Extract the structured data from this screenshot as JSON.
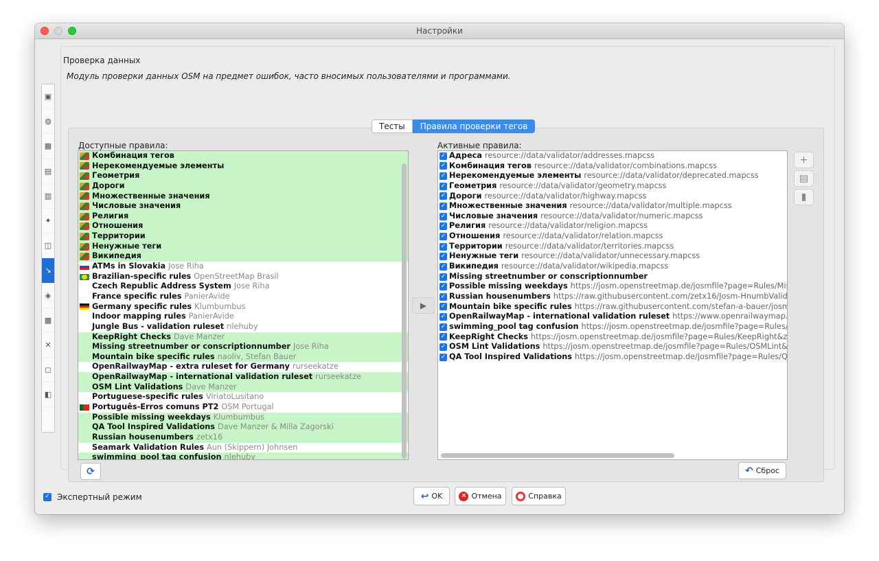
{
  "window": {
    "title": "Настройки"
  },
  "header": {
    "title": "Проверка данных",
    "description": "Модуль проверки данных OSM на предмет ошибок, часто вносимых пользователями и программами."
  },
  "tabs": [
    {
      "label": "Тесты"
    },
    {
      "label": "Правила проверки тегов"
    }
  ],
  "available": {
    "label": "Доступные правила:",
    "items": [
      {
        "name": "Комбинация тегов",
        "author": "",
        "icon": "josm",
        "hl": true
      },
      {
        "name": "Нерекомендуемые элементы",
        "author": "",
        "icon": "josm",
        "hl": true
      },
      {
        "name": "Геометрия",
        "author": "",
        "icon": "josm",
        "hl": true
      },
      {
        "name": "Дороги",
        "author": "",
        "icon": "josm",
        "hl": true
      },
      {
        "name": "Множественные значения",
        "author": "",
        "icon": "josm",
        "hl": true
      },
      {
        "name": "Числовые значения",
        "author": "",
        "icon": "josm",
        "hl": true
      },
      {
        "name": "Религия",
        "author": "",
        "icon": "josm",
        "hl": true
      },
      {
        "name": "Отношения",
        "author": "",
        "icon": "josm",
        "hl": true
      },
      {
        "name": "Территории",
        "author": "",
        "icon": "josm",
        "hl": true
      },
      {
        "name": "Ненужные теги",
        "author": "",
        "icon": "josm",
        "hl": true
      },
      {
        "name": "Википедия",
        "author": "",
        "icon": "josm",
        "hl": true
      },
      {
        "name": "ATMs in Slovakia",
        "author": "Jose Riha",
        "icon": "sk",
        "hl": false
      },
      {
        "name": "Brazilian-specific rules",
        "author": "OpenStreetMap Brasil",
        "icon": "br",
        "hl": false
      },
      {
        "name": "Czech Republic Address System",
        "author": "Jose Riha",
        "icon": "",
        "hl": false
      },
      {
        "name": "France specific rules",
        "author": "PanierAvide",
        "icon": "",
        "hl": false
      },
      {
        "name": "Germany specific rules",
        "author": "Klumbumbus",
        "icon": "de",
        "hl": false
      },
      {
        "name": "Indoor mapping rules",
        "author": "PanierAvide",
        "icon": "",
        "hl": false
      },
      {
        "name": "Jungle Bus - validation ruleset",
        "author": "nlehuby",
        "icon": "",
        "hl": false
      },
      {
        "name": "KeepRight Checks",
        "author": "Dave Manzer",
        "icon": "",
        "hl": true
      },
      {
        "name": "Missing streetnumber or conscriptionnumber",
        "author": "Jose Riha",
        "icon": "",
        "hl": true
      },
      {
        "name": "Mountain bike specific rules",
        "author": "naoliv, Stefan Bauer",
        "icon": "",
        "hl": true
      },
      {
        "name": "OpenRailwayMap - extra ruleset for Germany",
        "author": "rurseekatze",
        "icon": "",
        "hl": false
      },
      {
        "name": "OpenRailwayMap - international validation ruleset",
        "author": "rurseekatze",
        "icon": "",
        "hl": true
      },
      {
        "name": "OSM Lint Validations",
        "author": "Dave Manzer",
        "icon": "",
        "hl": true
      },
      {
        "name": "Portuguese-specific rules",
        "author": "ViriatoLusitano",
        "icon": "",
        "hl": false
      },
      {
        "name": "Português-Erros comuns PT2",
        "author": "OSM Portugal",
        "icon": "pt",
        "hl": false
      },
      {
        "name": "Possible missing weekdays",
        "author": "Klumbumbus",
        "icon": "",
        "hl": true
      },
      {
        "name": "QA Tool Inspired Validations",
        "author": "Dave Manzer & Milla Zagorski",
        "icon": "",
        "hl": true
      },
      {
        "name": "Russian housenumbers",
        "author": "zetx16",
        "icon": "",
        "hl": true
      },
      {
        "name": "Seamark Validation Rules",
        "author": "Aun (Skippern) Johnsen",
        "icon": "",
        "hl": false
      },
      {
        "name": "swimming_pool tag confusion",
        "author": "nlehuby",
        "icon": "",
        "hl": true
      }
    ]
  },
  "active": {
    "label": "Активные правила:",
    "items": [
      {
        "name": "Адреса",
        "src": "resource://data/validator/addresses.mapcss"
      },
      {
        "name": "Комбинация тегов",
        "src": "resource://data/validator/combinations.mapcss"
      },
      {
        "name": "Нерекомендуемые элементы",
        "src": "resource://data/validator/deprecated.mapcss"
      },
      {
        "name": "Геометрия",
        "src": "resource://data/validator/geometry.mapcss"
      },
      {
        "name": "Дороги",
        "src": "resource://data/validator/highway.mapcss"
      },
      {
        "name": "Множественные значения",
        "src": "resource://data/validator/multiple.mapcss"
      },
      {
        "name": "Числовые значения",
        "src": "resource://data/validator/numeric.mapcss"
      },
      {
        "name": "Религия",
        "src": "resource://data/validator/religion.mapcss"
      },
      {
        "name": "Отношения",
        "src": "resource://data/validator/relation.mapcss"
      },
      {
        "name": "Территории",
        "src": "resource://data/validator/territories.mapcss"
      },
      {
        "name": "Ненужные теги",
        "src": "resource://data/validator/unnecessary.mapcss"
      },
      {
        "name": "Википедия",
        "src": "resource://data/validator/wikipedia.mapcss"
      },
      {
        "name": "Missing streetnumber or conscriptionnumber",
        "src": ""
      },
      {
        "name": "Possible missing weekdays",
        "src": "https://josm.openstreetmap.de/josmfile?page=Rules/Missing\\"
      },
      {
        "name": "Russian housenumbers",
        "src": "https://raw.githubusercontent.com/zetx16/Josm-HnumbValidator"
      },
      {
        "name": "Mountain bike specific rules",
        "src": "https://raw.githubusercontent.com/stefan-a-bauer/josm-val"
      },
      {
        "name": "OpenRailwayMap - international validation ruleset",
        "src": "https://www.openrailwaymap.org/vali"
      },
      {
        "name": "swimming_pool tag confusion",
        "src": "https://josm.openstreetmap.de/josmfile?page=Rules/Susp"
      },
      {
        "name": "KeepRight Checks",
        "src": "https://josm.openstreetmap.de/josmfile?page=Rules/KeepRight&zip=1"
      },
      {
        "name": "OSM Lint Validations",
        "src": "https://josm.openstreetmap.de/josmfile?page=Rules/OSMLint&zip=1"
      },
      {
        "name": "QA Tool Inspired Validations",
        "src": "https://josm.openstreetmap.de/josmfile?page=Rules/QATo"
      }
    ]
  },
  "buttons": {
    "reset": "Сброс",
    "ok": "OK",
    "cancel": "Отмена",
    "help": "Справка"
  },
  "expert_mode": {
    "label": "Экспертный режим",
    "checked": true
  },
  "sidebar_icons": [
    "display-icon",
    "globe-icon",
    "map-icon",
    "toolbar-icon",
    "shortcut-icon",
    "projection-icon",
    "remote-control-icon",
    "validator-icon",
    "plugins-icon",
    "imagery-icon",
    "tools-icon",
    "settings-icon",
    "advanced-icon"
  ]
}
